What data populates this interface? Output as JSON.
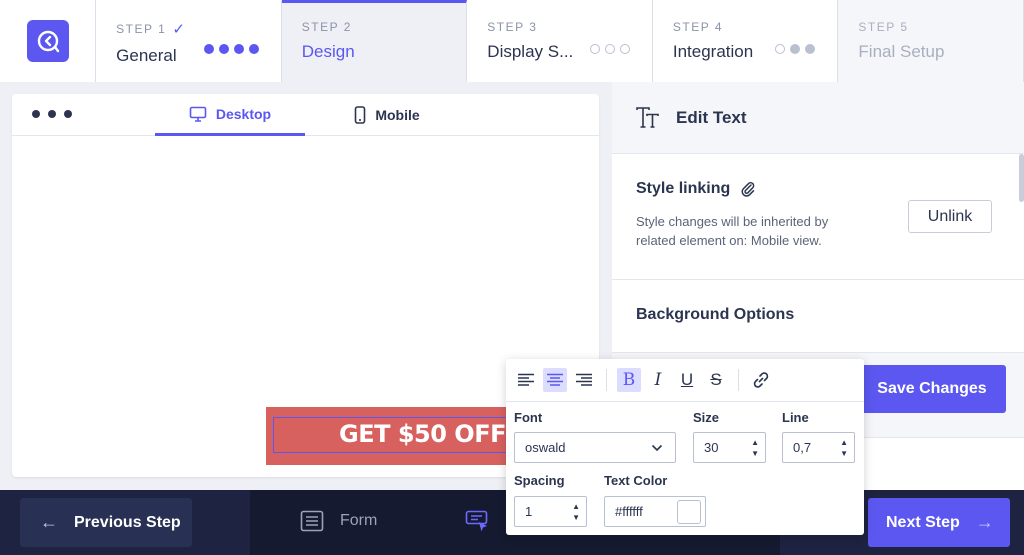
{
  "steps": [
    {
      "num": "STEP 1",
      "name": "General",
      "check": "✓"
    },
    {
      "num": "STEP 2",
      "name": "Design"
    },
    {
      "num": "STEP 3",
      "name": "Display S..."
    },
    {
      "num": "STEP 4",
      "name": "Integration"
    },
    {
      "num": "STEP 5",
      "name": "Final Setup"
    }
  ],
  "preview": {
    "tab_desktop": "Desktop",
    "tab_mobile": "Mobile",
    "banner_text": "GET $50 OFF"
  },
  "panel": {
    "title": "Edit Text",
    "style_linking": {
      "heading": "Style linking",
      "description": "Style changes will be inherited by related element on: Mobile view.",
      "unlink_label": "Unlink"
    },
    "background_options": "Background Options",
    "save_label": "Save Changes"
  },
  "toolbar": {
    "font_label": "Font",
    "font_value": "oswald",
    "size_label": "Size",
    "size_value": "30",
    "line_label": "Line",
    "line_value": "0,7",
    "spacing_label": "Spacing",
    "spacing_value": "1",
    "color_label": "Text Color",
    "color_value": "#ffffff"
  },
  "bottom": {
    "prev_label": "Previous Step",
    "form_label": "Form",
    "next_label": "Next Step"
  },
  "colors": {
    "accent": "#5b57f0",
    "banner": "#d7615f",
    "bottom_bar": "#1d2340"
  }
}
